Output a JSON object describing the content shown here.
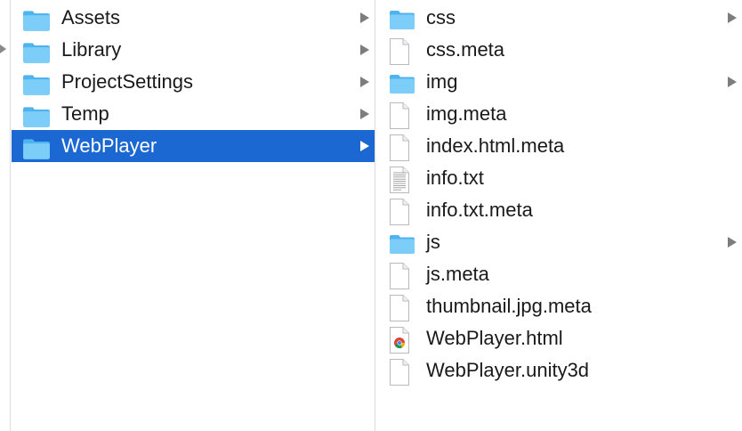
{
  "column1": {
    "items": [
      {
        "name": "Assets",
        "kind": "folder",
        "expandable": true,
        "selected": false
      },
      {
        "name": "Library",
        "kind": "folder",
        "expandable": true,
        "selected": false
      },
      {
        "name": "ProjectSettings",
        "kind": "folder",
        "expandable": true,
        "selected": false
      },
      {
        "name": "Temp",
        "kind": "folder",
        "expandable": true,
        "selected": false
      },
      {
        "name": "WebPlayer",
        "kind": "folder",
        "expandable": true,
        "selected": true
      }
    ]
  },
  "column2": {
    "items": [
      {
        "name": "css",
        "kind": "folder",
        "expandable": true
      },
      {
        "name": "css.meta",
        "kind": "file",
        "expandable": false
      },
      {
        "name": "img",
        "kind": "folder",
        "expandable": true
      },
      {
        "name": "img.meta",
        "kind": "file",
        "expandable": false
      },
      {
        "name": "index.html.meta",
        "kind": "file",
        "expandable": false
      },
      {
        "name": "info.txt",
        "kind": "text-file",
        "expandable": false
      },
      {
        "name": "info.txt.meta",
        "kind": "file",
        "expandable": false
      },
      {
        "name": "js",
        "kind": "folder",
        "expandable": true
      },
      {
        "name": "js.meta",
        "kind": "file",
        "expandable": false
      },
      {
        "name": "thumbnail.jpg.meta",
        "kind": "file",
        "expandable": false
      },
      {
        "name": "WebPlayer.html",
        "kind": "html-file",
        "expandable": false
      },
      {
        "name": "WebPlayer.unity3d",
        "kind": "file",
        "expandable": false
      }
    ]
  },
  "colors": {
    "selection": "#1b68d2",
    "folder": "#6cc4f5",
    "text": "#1a1a1a"
  },
  "icons": {
    "folder": "folder-icon",
    "file": "blank-document-icon",
    "text-file": "text-document-icon",
    "html-file": "chrome-document-icon",
    "expand": "disclosure-arrow-icon"
  }
}
